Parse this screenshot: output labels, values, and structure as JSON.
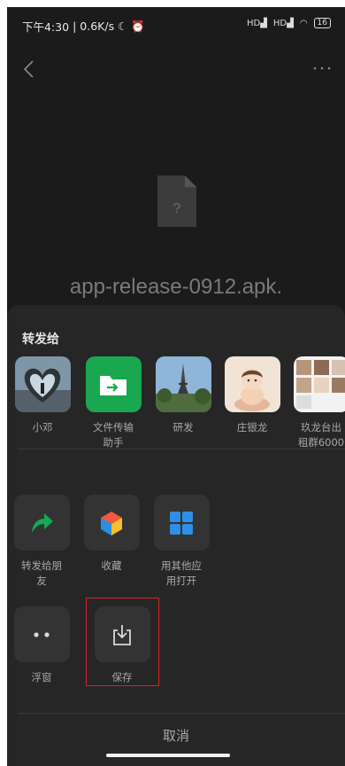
{
  "status": {
    "time": "下午4:30",
    "speed": "0.6K/s",
    "signal1": "HD",
    "signal2": "HD",
    "battery": "16"
  },
  "file": {
    "name": "app-release-0912.apk."
  },
  "sheet": {
    "title": "转发给",
    "contacts": [
      {
        "label": "小邓"
      },
      {
        "label": "文件传输\n助手"
      },
      {
        "label": "研发"
      },
      {
        "label": "庄银龙"
      },
      {
        "label": "玖龙台出\n租群6000"
      }
    ],
    "actions": [
      {
        "label": "转发给朋\n友"
      },
      {
        "label": "收藏"
      },
      {
        "label": "用其他应\n用打开"
      },
      {
        "label": "浮窗"
      },
      {
        "label": "保存"
      }
    ],
    "cancel": "取消"
  },
  "colors": {
    "highlight": "#d3262a",
    "wechat_green": "#19a750"
  }
}
